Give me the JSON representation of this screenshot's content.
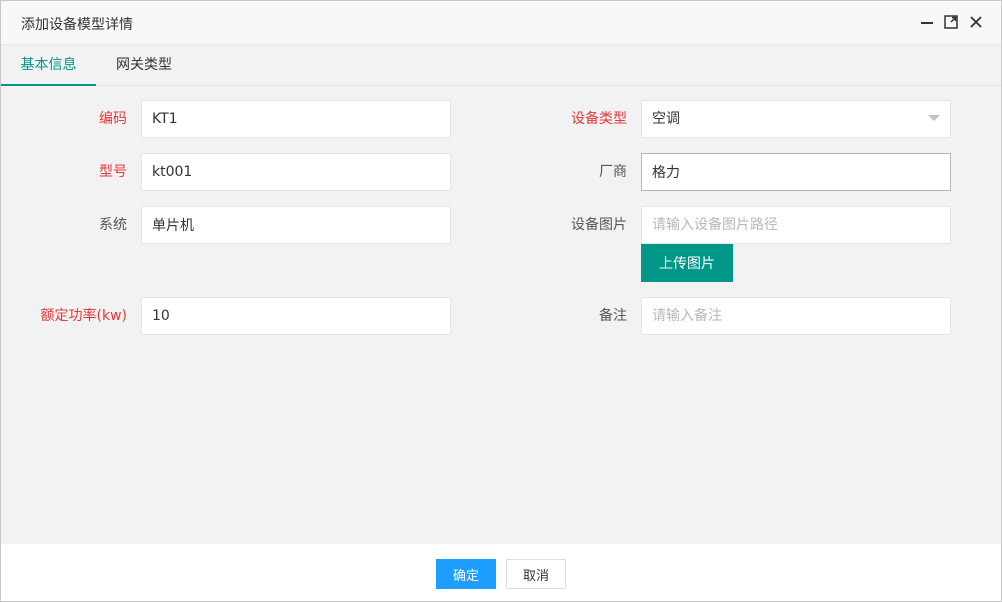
{
  "dialog": {
    "title": "添加设备模型详情"
  },
  "window_controls": {
    "minimize": "minimize-icon",
    "maximize": "maximize-icon",
    "close": "close-icon"
  },
  "tabs": [
    {
      "label": "基本信息",
      "active": true
    },
    {
      "label": "网关类型",
      "active": false
    }
  ],
  "form": {
    "code": {
      "label": "编码",
      "value": "KT1",
      "required": true
    },
    "model": {
      "label": "型号",
      "value": "kt001",
      "required": true
    },
    "system": {
      "label": "系统",
      "value": "单片机",
      "required": false
    },
    "rated_power": {
      "label": "额定功率(kw)",
      "value": "10",
      "required": true
    },
    "device_type": {
      "label": "设备类型",
      "value": "空调",
      "required": true
    },
    "manufacturer": {
      "label": "厂商",
      "value": "格力",
      "required": false
    },
    "device_image": {
      "label": "设备图片",
      "value": "",
      "placeholder": "请输入设备图片路径",
      "required": false
    },
    "upload_button": "上传图片",
    "remark": {
      "label": "备注",
      "value": "",
      "placeholder": "请输入备注",
      "required": false
    }
  },
  "footer": {
    "ok_label": "确定",
    "cancel_label": "取消"
  },
  "colors": {
    "accent": "#009688",
    "primary_button": "#1e9fff",
    "required_label": "#e4393c"
  }
}
